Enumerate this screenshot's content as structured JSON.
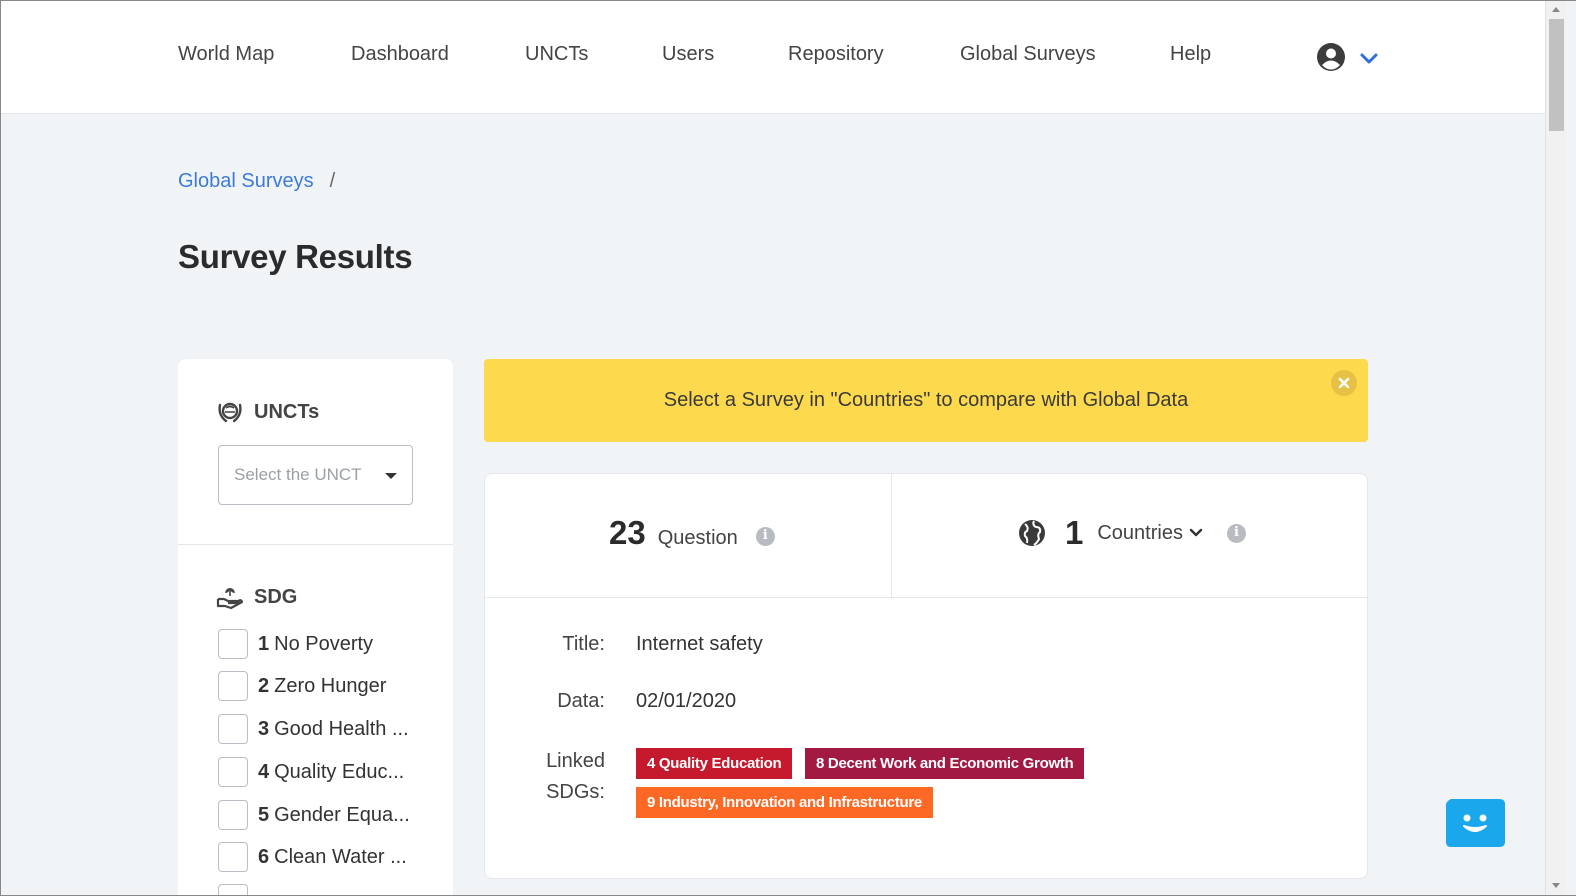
{
  "nav": {
    "items": [
      "World Map",
      "Dashboard",
      "UNCTs",
      "Users",
      "Repository",
      "Global Surveys",
      "Help"
    ],
    "user_icon": "user-circle-icon",
    "menu_icon": "chevron-down-icon"
  },
  "breadcrumb": {
    "link": "Global Surveys",
    "separator": "/"
  },
  "page": {
    "title": "Survey Results"
  },
  "sidebar": {
    "uncts_heading": "UNCTs",
    "unct_select_placeholder": "Select the UNCT",
    "sdg_heading": "SDG",
    "sdg_items": [
      {
        "num": "1",
        "label": "No Poverty"
      },
      {
        "num": "2",
        "label": "Zero Hunger"
      },
      {
        "num": "3",
        "label": "Good Health ..."
      },
      {
        "num": "4",
        "label": "Quality Educ..."
      },
      {
        "num": "5",
        "label": "Gender Equa..."
      },
      {
        "num": "6",
        "label": "Clean Water ..."
      }
    ]
  },
  "alert": {
    "text": "Select a Survey in \"Countries\" to compare with Global Data"
  },
  "stats": {
    "question_count": "23",
    "question_label": "Question",
    "country_count": "1",
    "countries_label": "Countries"
  },
  "survey": {
    "title_label": "Title:",
    "title_value": "Internet safety",
    "date_label": "Data:",
    "date_value": "02/01/2020",
    "sdgs_label_1": "Linked",
    "sdgs_label_2": "SDGs:",
    "tags": [
      {
        "label": "4 Quality Education",
        "color": "#c5192d"
      },
      {
        "label": "8 Decent Work and Economic Growth",
        "color": "#a21942"
      },
      {
        "label": "9 Industry, Innovation and Infrastructure",
        "color": "#fd6925"
      }
    ]
  },
  "colors": {
    "link": "#3d7bd9",
    "alert_bg": "#fdd94e",
    "chat": "#1aa7ec"
  }
}
